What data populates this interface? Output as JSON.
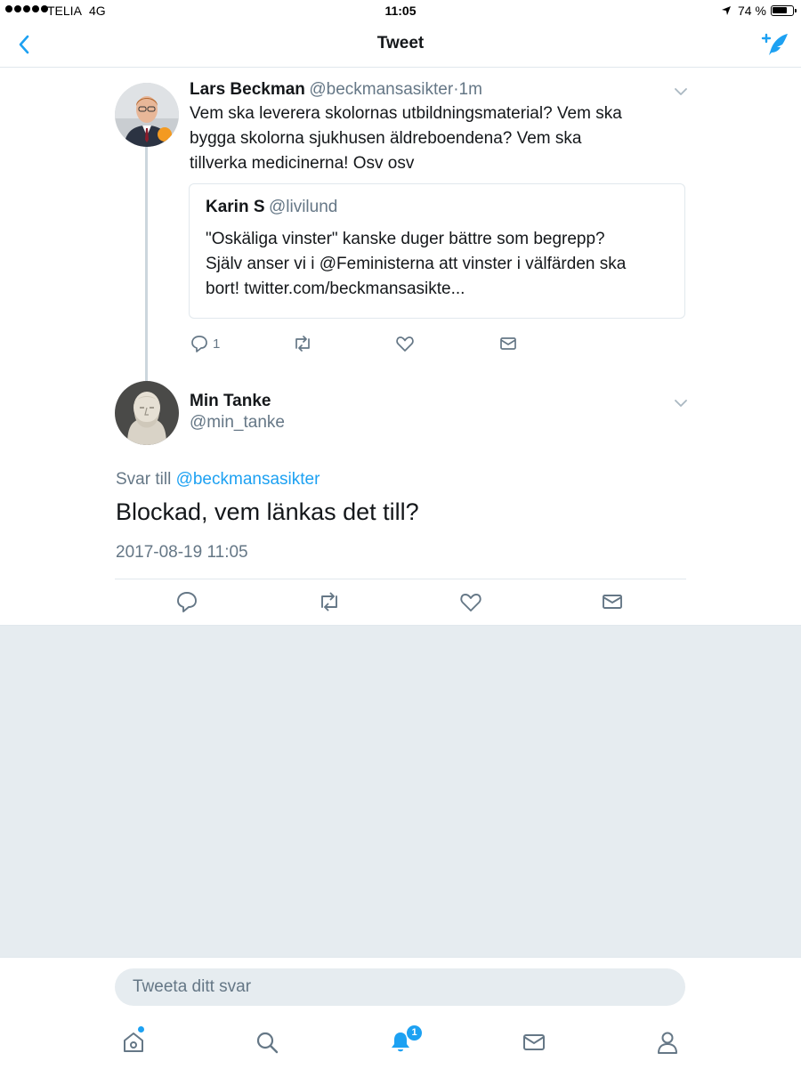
{
  "status_bar": {
    "carrier": "TELIA",
    "network": "4G",
    "time": "11:05",
    "battery_percent": "74 %"
  },
  "nav": {
    "title": "Tweet",
    "back_icon": "chevron-left-icon",
    "compose_icon": "compose-feather-icon"
  },
  "parent_tweet": {
    "name": "Lars Beckman",
    "handle": "@beckmansasikter",
    "time": "·1m",
    "text_lines": [
      "Vem ska leverera skolornas utbildningsmaterial? Vem ska",
      "bygga skolorna sjukhusen äldreboendena? Vem ska",
      "tillverka medicinerna! Osv osv"
    ],
    "quote": {
      "name": "Karin S",
      "handle": "@livilund",
      "text_lines": [
        "\"Oskäliga vinster\" kanske duger bättre som begrepp?",
        "Själv anser vi i @Feministerna att vinster i välfärden ska",
        "bort! twitter.com/beckmansasikte..."
      ]
    },
    "reply_count": "1"
  },
  "main_tweet": {
    "name": "Min Tanke",
    "handle": "@min_tanke",
    "reply_prefix": "Svar till",
    "reply_to": "@beckmansasikter",
    "text": "Blockad, vem länkas det till?",
    "timestamp": "2017-08-19 11:05"
  },
  "reply_box": {
    "placeholder": "Tweeta ditt svar"
  },
  "tab_bar": {
    "notification_badge": "1"
  },
  "colors": {
    "accent": "#1da1f2",
    "secondary_text": "#657786",
    "border": "#e1e8ed",
    "background_grey": "#e6ecf0"
  }
}
